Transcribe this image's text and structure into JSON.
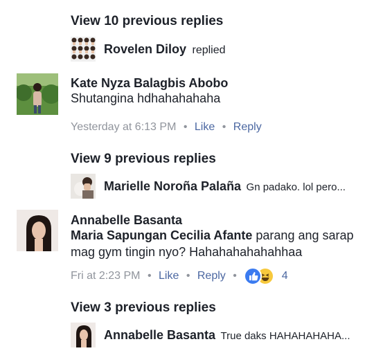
{
  "thread1": {
    "view_previous": "View 10 previous replies",
    "reply_preview": {
      "author": "Rovelen Diloy",
      "action": "replied"
    }
  },
  "comment1": {
    "author": "Kate Nyza Balagbis Abobo",
    "text": "Shutangina hdhahahahaha",
    "timestamp": "Yesterday at 6:13 PM",
    "like_label": "Like",
    "reply_label": "Reply",
    "view_previous": "View 9 previous replies",
    "reply_preview": {
      "author": "Marielle Noroña Palaña",
      "snippet": "Gn padako. lol pero..."
    }
  },
  "comment2": {
    "author": "Annabelle Basanta",
    "mention": "Maria Sapungan Cecilia Afante",
    "text_after_mention": " parang ang sarap",
    "text_line2": "mag gym tingin nyo? Hahahahahahahhaa",
    "timestamp": "Fri at 2:23 PM",
    "like_label": "Like",
    "reply_label": "Reply",
    "reaction_count": "4",
    "reactions": [
      "like-icon",
      "haha-icon"
    ],
    "view_previous": "View 3 previous replies",
    "reply_preview": {
      "author": "Annabelle Basanta",
      "snippet": "True daks HAHAHAHAHA..."
    }
  },
  "colors": {
    "text": "#1d2129",
    "meta": "#90949c",
    "link": "#4b67a1",
    "like_blue": "#3b7bf0",
    "haha_yellow": "#f7c93d"
  }
}
